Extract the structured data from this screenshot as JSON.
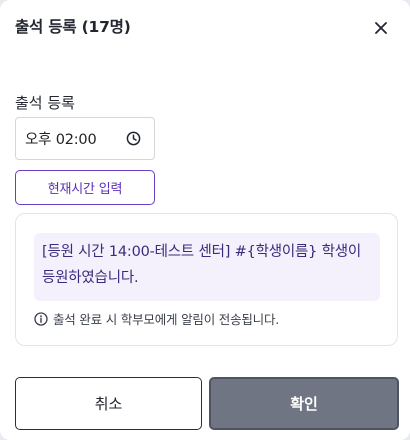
{
  "dialog": {
    "title": "출석 등록 (17명)",
    "close_icon": "close-icon"
  },
  "form": {
    "time_label": "출석 등록",
    "time_value": "오후 02:00",
    "clock_icon": "clock-icon",
    "now_button_label": "현재시간 입력"
  },
  "preview": {
    "message": "[등원 시간 14:00-테스트 센터] #{학생이름} 학생이 등원하였습니다.",
    "info_icon": "info-icon",
    "notice": "출석 완료 시 학부모에게 알림이 전송됩니다."
  },
  "footer": {
    "cancel_label": "취소",
    "confirm_label": "확인"
  },
  "colors": {
    "accent": "#6b3fc4",
    "message_bg": "#f4f1fd",
    "confirm_bg": "#6f7583"
  }
}
